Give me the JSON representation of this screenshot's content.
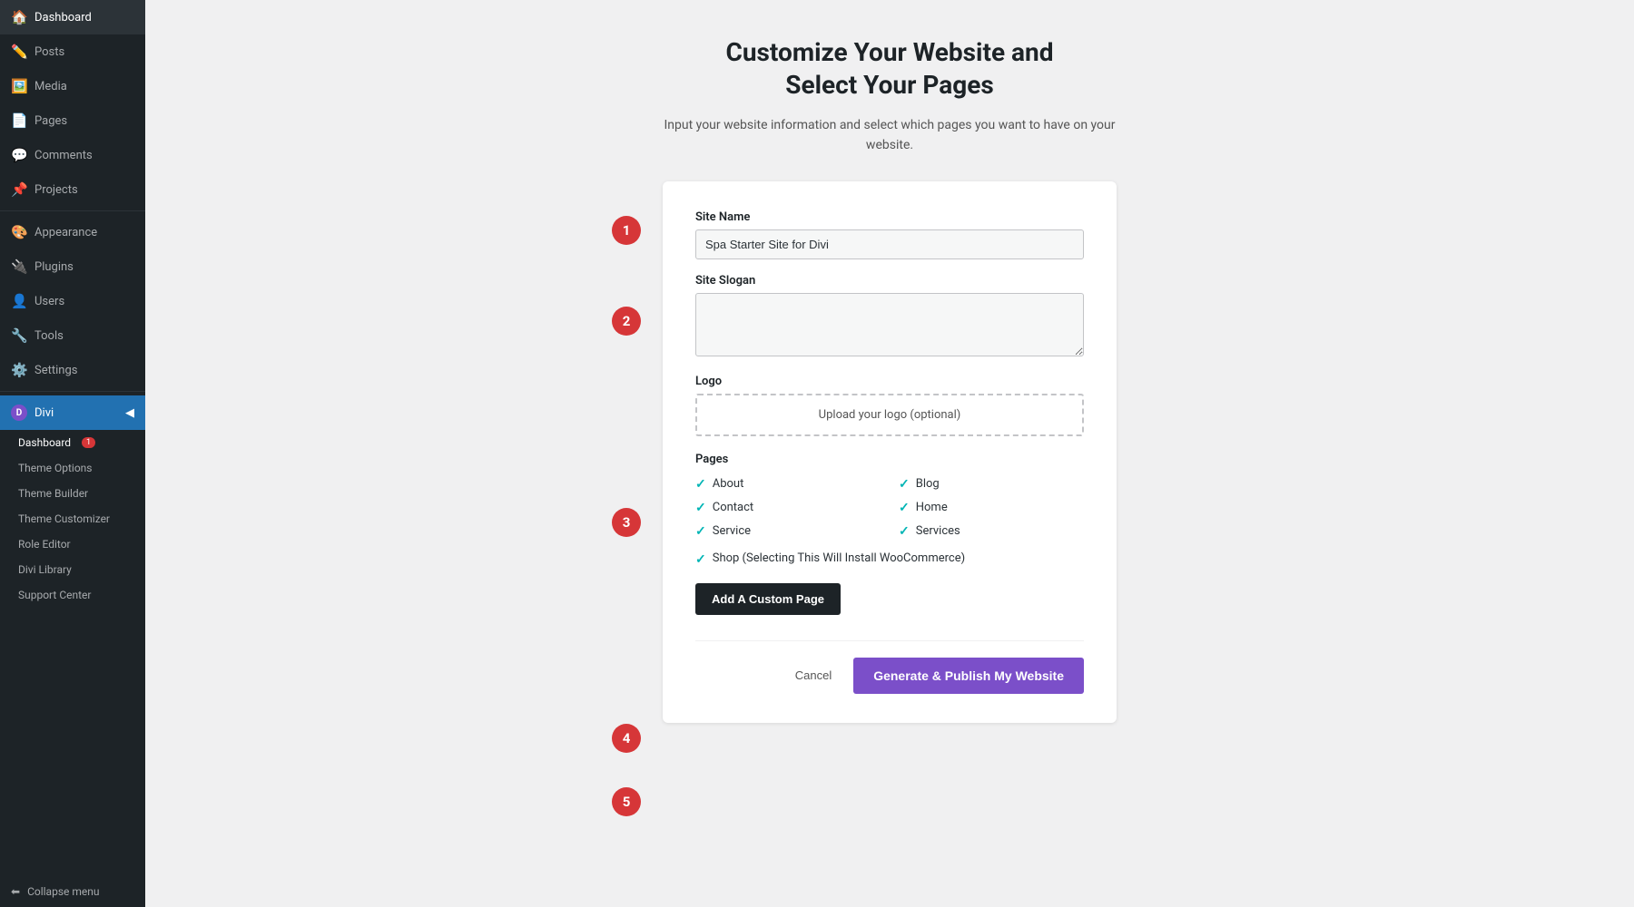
{
  "sidebar": {
    "items": [
      {
        "id": "dashboard",
        "label": "Dashboard",
        "icon": "🏠"
      },
      {
        "id": "posts",
        "label": "Posts",
        "icon": "✏️"
      },
      {
        "id": "media",
        "label": "Media",
        "icon": "🖼️"
      },
      {
        "id": "pages",
        "label": "Pages",
        "icon": "📄"
      },
      {
        "id": "comments",
        "label": "Comments",
        "icon": "💬"
      },
      {
        "id": "projects",
        "label": "Projects",
        "icon": "📌"
      },
      {
        "id": "appearance",
        "label": "Appearance",
        "icon": "🎨"
      },
      {
        "id": "plugins",
        "label": "Plugins",
        "icon": "🔌"
      },
      {
        "id": "users",
        "label": "Users",
        "icon": "👤"
      },
      {
        "id": "tools",
        "label": "Tools",
        "icon": "🔧"
      },
      {
        "id": "settings",
        "label": "Settings",
        "icon": "⚙️"
      }
    ],
    "divi": {
      "label": "Divi",
      "sub_items": [
        {
          "id": "divi-dashboard",
          "label": "Dashboard",
          "badge": "1"
        },
        {
          "id": "theme-options",
          "label": "Theme Options"
        },
        {
          "id": "theme-builder",
          "label": "Theme Builder"
        },
        {
          "id": "theme-customizer",
          "label": "Theme Customizer"
        },
        {
          "id": "role-editor",
          "label": "Role Editor"
        },
        {
          "id": "divi-library",
          "label": "Divi Library"
        },
        {
          "id": "support-center",
          "label": "Support Center"
        }
      ]
    },
    "collapse_label": "Collapse menu"
  },
  "main": {
    "title_line1": "Customize Your Website and",
    "title_line2": "Select Your Pages",
    "subtitle": "Input your website information and select which pages you want to have on your website.",
    "form": {
      "site_name_label": "Site Name",
      "site_name_value": "Spa Starter Site for Divi",
      "site_slogan_label": "Site Slogan",
      "site_slogan_placeholder": "",
      "logo_label": "Logo",
      "logo_upload_text": "Upload your logo (optional)",
      "pages_label": "Pages",
      "pages": [
        {
          "name": "About",
          "checked": true
        },
        {
          "name": "Blog",
          "checked": true
        },
        {
          "name": "Contact",
          "checked": true
        },
        {
          "name": "Home",
          "checked": true
        },
        {
          "name": "Service",
          "checked": true
        },
        {
          "name": "Services",
          "checked": true
        }
      ],
      "shop_label": "Shop (Selecting This Will Install WooCommerce)",
      "shop_checked": true,
      "add_custom_label": "Add A Custom Page",
      "cancel_label": "Cancel",
      "publish_label": "Generate & Publish My Website"
    }
  },
  "steps": [
    {
      "number": "1"
    },
    {
      "number": "2"
    },
    {
      "number": "3"
    },
    {
      "number": "4"
    },
    {
      "number": "5"
    }
  ]
}
